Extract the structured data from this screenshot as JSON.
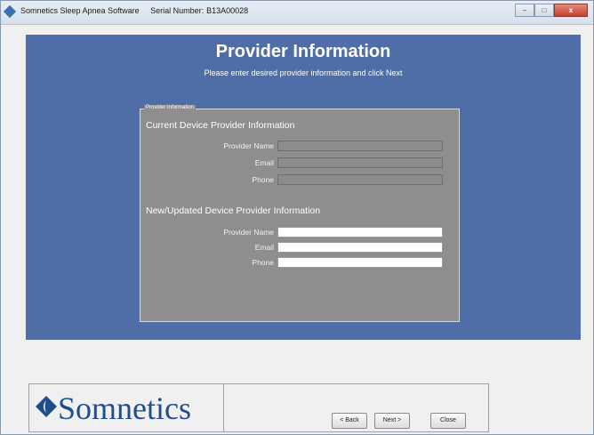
{
  "window": {
    "app_name": "Somnetics Sleep Apnea Software",
    "serial_label": "Serial Number:",
    "serial_value": "B13A00028",
    "controls": {
      "minimize": "–",
      "maximize": "□",
      "close": "x"
    }
  },
  "page": {
    "title": "Provider Information",
    "subtitle": "Please enter desired provider information and click Next"
  },
  "group": {
    "legend": "Provider Information",
    "current": {
      "heading": "Current Device Provider Information",
      "fields": [
        {
          "label": "Provider Name",
          "value": ""
        },
        {
          "label": "Email",
          "value": ""
        },
        {
          "label": "Phone",
          "value": ""
        }
      ]
    },
    "updated": {
      "heading": "New/Updated Device Provider Information",
      "fields": [
        {
          "label": "Provider Name",
          "value": ""
        },
        {
          "label": "Email",
          "value": ""
        },
        {
          "label": "Phone",
          "value": ""
        }
      ]
    }
  },
  "footer": {
    "logo_text": "Somnetics",
    "back_label": "< Back",
    "next_label": "Next >",
    "close_label": "Close"
  },
  "colors": {
    "panel_blue": "#4f6ea8",
    "group_gray": "#8e8e8e",
    "logo_blue": "#1f4e8c"
  }
}
